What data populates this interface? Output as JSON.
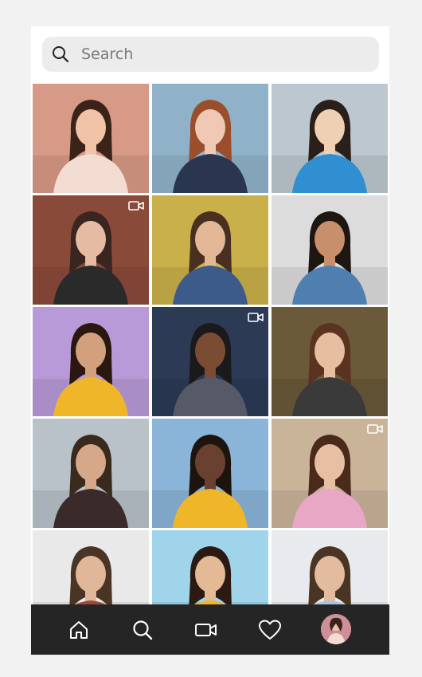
{
  "search": {
    "placeholder": "Search"
  },
  "grid": {
    "tiles": [
      {
        "name": "tile-woman-pink-dress",
        "bg": "#d79a86",
        "skin": "#f0c3a6",
        "hair": "#3a2319",
        "shirt": "#f3ddd3",
        "video": false
      },
      {
        "name": "tile-redhead-woman",
        "bg": "#8fb2c9",
        "skin": "#efc9b3",
        "hair": "#9a4e2b",
        "shirt": "#2a3550",
        "video": false
      },
      {
        "name": "tile-woman-blue-top",
        "bg": "#bcc7cf",
        "skin": "#f0d0b5",
        "hair": "#2b1f1a",
        "shirt": "#2f8fd0",
        "video": false
      },
      {
        "name": "tile-woman-selfie",
        "bg": "#8a4a3a",
        "skin": "#e5bba3",
        "hair": "#3a2520",
        "shirt": "#2a2a2a",
        "video": true
      },
      {
        "name": "tile-man-sitting-chair",
        "bg": "#c9b04a",
        "skin": "#e2b897",
        "hair": "#4a3020",
        "shirt": "#3c5a8a",
        "video": false
      },
      {
        "name": "tile-man-ok-gesture",
        "bg": "#dcdcdc",
        "skin": "#c8906a",
        "hair": "#1e1610",
        "shirt": "#4f7fb0",
        "video": false
      },
      {
        "name": "tile-curly-woman-purple",
        "bg": "#b89ad8",
        "skin": "#d2a07c",
        "hair": "#2a1810",
        "shirt": "#f0b62a",
        "video": false
      },
      {
        "name": "tile-man-suit-stage",
        "bg": "#2c3a56",
        "skin": "#7a4c34",
        "hair": "#1a1a1a",
        "shirt": "#555a66",
        "video": true
      },
      {
        "name": "tile-woman-striped-shirt",
        "bg": "#6a5a3a",
        "skin": "#e6bea0",
        "hair": "#5a3420",
        "shirt": "#3a3a3a",
        "video": false
      },
      {
        "name": "tile-bearded-man",
        "bg": "#b8c2c8",
        "skin": "#d6a88a",
        "hair": "#3a2a1e",
        "shirt": "#3a2a2a",
        "video": false
      },
      {
        "name": "tile-laughing-woman-city",
        "bg": "#8ab4d8",
        "skin": "#6a4030",
        "hair": "#1e140e",
        "shirt": "#f0b62a",
        "video": false
      },
      {
        "name": "tile-woman-doorway",
        "bg": "#c9b49a",
        "skin": "#e7c0a3",
        "hair": "#4a2a1a",
        "shirt": "#e9a7c6",
        "video": true
      },
      {
        "name": "tile-man-plaid-shirt",
        "bg": "#e9e9e9",
        "skin": "#e1b79a",
        "hair": "#4a3424",
        "shirt": "#9a4a3a",
        "video": false
      },
      {
        "name": "tile-woman-yellow-shirt",
        "bg": "#9fd4ea",
        "skin": "#e4b996",
        "hair": "#2a1a12",
        "shirt": "#f0b62a",
        "video": false
      },
      {
        "name": "tile-man-glasses-blue-shirt",
        "bg": "#e9eaee",
        "skin": "#e3bca0",
        "hair": "#4a3424",
        "shirt": "#a9c4e0",
        "video": false
      }
    ]
  },
  "nav": {
    "items": [
      {
        "name": "nav-home",
        "icon": "home-icon"
      },
      {
        "name": "nav-search",
        "icon": "search-icon"
      },
      {
        "name": "nav-videos",
        "icon": "video-camera-icon"
      },
      {
        "name": "nav-favorites",
        "icon": "heart-icon"
      },
      {
        "name": "nav-profile",
        "icon": "profile-avatar"
      }
    ]
  }
}
